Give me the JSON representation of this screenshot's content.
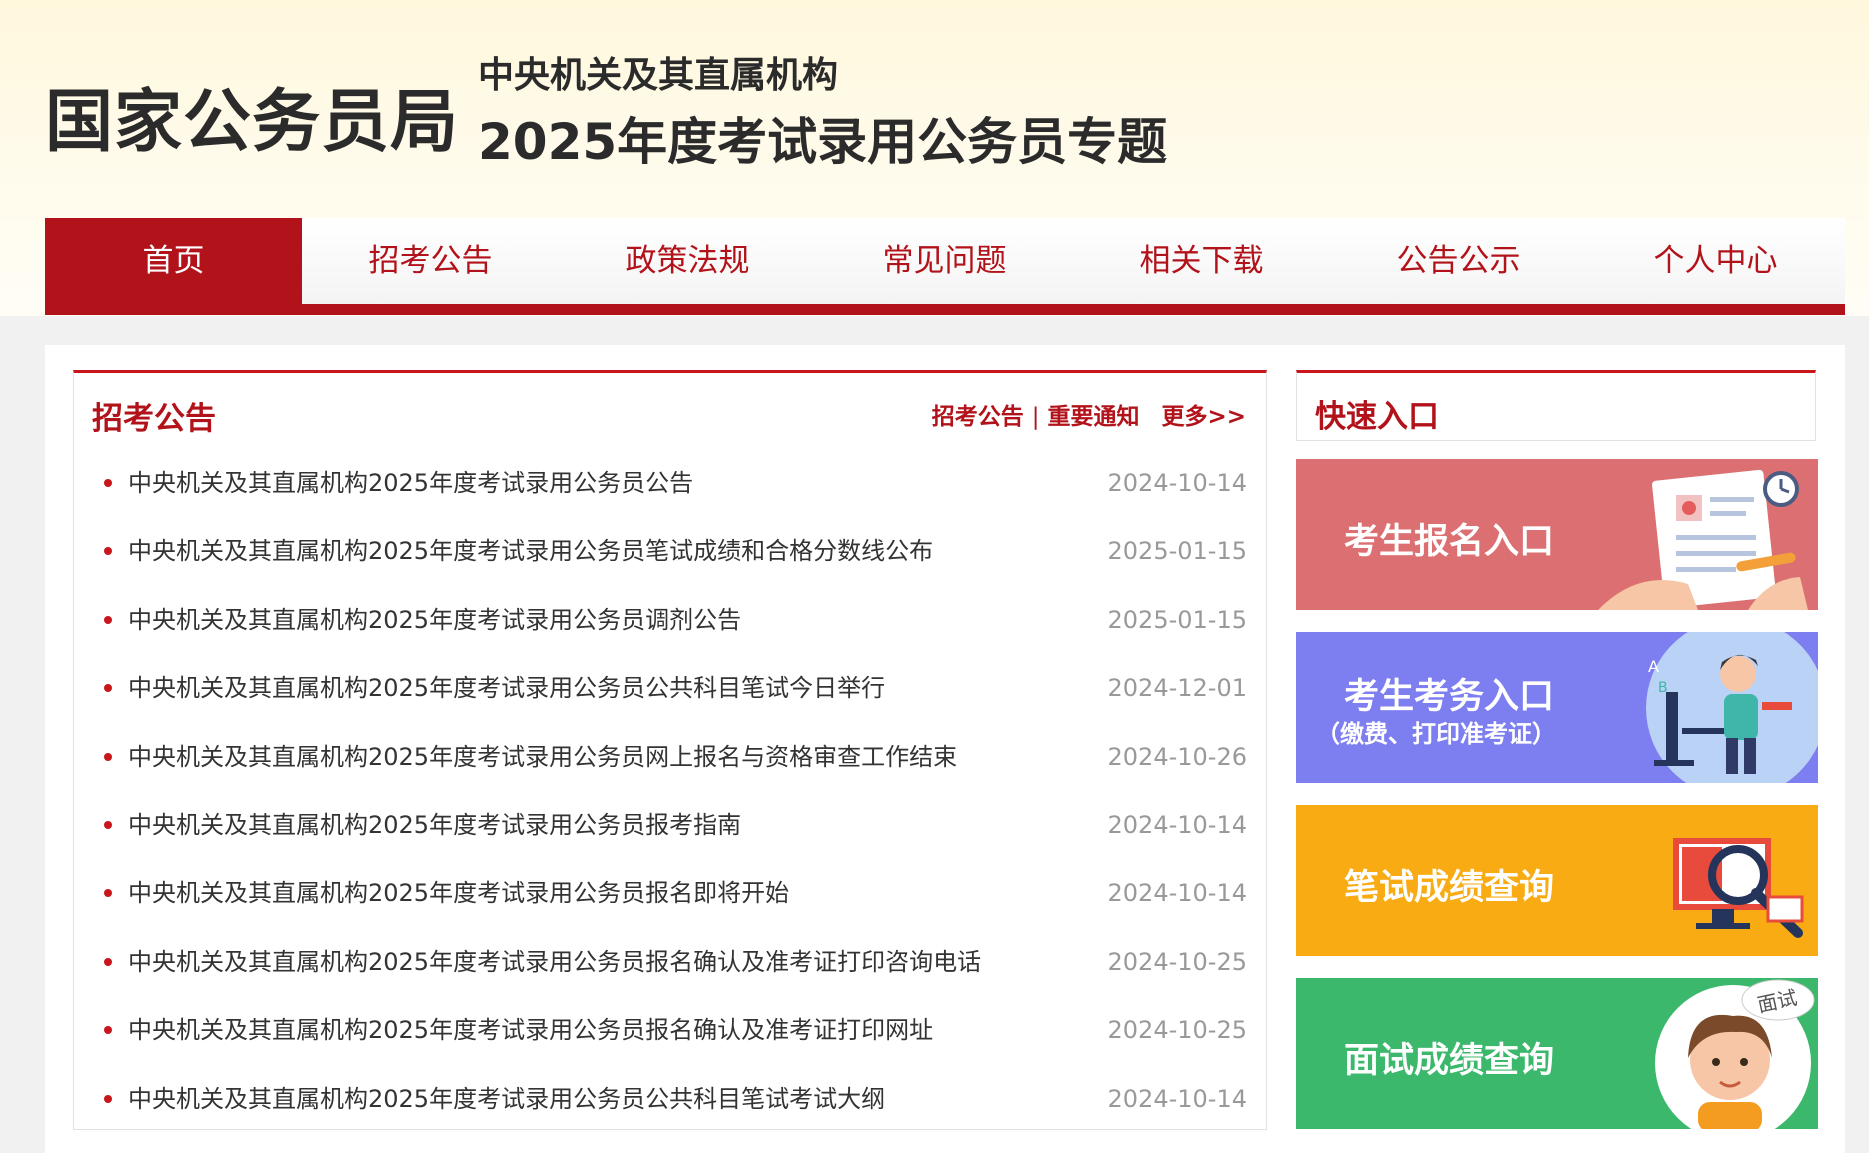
{
  "header": {
    "logo": "国家公务员局",
    "subtitle_line1": "中央机关及其直属机构",
    "subtitle_line2": "2025年度考试录用公务员专题"
  },
  "nav": {
    "items": [
      "首页",
      "招考公告",
      "政策法规",
      "常见问题",
      "相关下载",
      "公告公示",
      "个人中心"
    ],
    "active_index": 0
  },
  "announcements": {
    "title": "招考公告",
    "links": [
      "招考公告",
      "重要通知"
    ],
    "more": "更多>>",
    "items": [
      {
        "title": "中央机关及其直属机构2025年度考试录用公务员公告",
        "date": "2024-10-14"
      },
      {
        "title": "中央机关及其直属机构2025年度考试录用公务员笔试成绩和合格分数线公布",
        "date": "2025-01-15"
      },
      {
        "title": "中央机关及其直属机构2025年度考试录用公务员调剂公告",
        "date": "2025-01-15"
      },
      {
        "title": "中央机关及其直属机构2025年度考试录用公务员公共科目笔试今日举行",
        "date": "2024-12-01"
      },
      {
        "title": "中央机关及其直属机构2025年度考试录用公务员网上报名与资格审查工作结束",
        "date": "2024-10-26"
      },
      {
        "title": "中央机关及其直属机构2025年度考试录用公务员报考指南",
        "date": "2024-10-14"
      },
      {
        "title": "中央机关及其直属机构2025年度考试录用公务员报名即将开始",
        "date": "2024-10-14"
      },
      {
        "title": "中央机关及其直属机构2025年度考试录用公务员报名确认及准考证打印咨询电话",
        "date": "2024-10-25"
      },
      {
        "title": "中央机关及其直属机构2025年度考试录用公务员报名确认及准考证打印网址",
        "date": "2024-10-25"
      },
      {
        "title": "中央机关及其直属机构2025年度考试录用公务员公共科目笔试考试大纲",
        "date": "2024-10-14"
      }
    ]
  },
  "quick_entry": {
    "title": "快速入口",
    "tiles": [
      {
        "label": "考生报名入口",
        "sub": "",
        "color": "#dc6f72",
        "icon": "application-form-icon"
      },
      {
        "label": "考生考务入口",
        "sub": "（缴费、打印准考证）",
        "color": "#7d7ef0",
        "icon": "computer-user-icon"
      },
      {
        "label": "笔试成绩查询",
        "sub": "",
        "color": "#f8ab12",
        "icon": "magnifier-screen-icon"
      },
      {
        "label": "面试成绩查询",
        "sub": "",
        "color": "#3bb86b",
        "icon": "interview-person-icon"
      }
    ],
    "interview_bubble": "面试"
  },
  "colors": {
    "brand_red": "#b2131a",
    "date_gray": "#999999"
  }
}
